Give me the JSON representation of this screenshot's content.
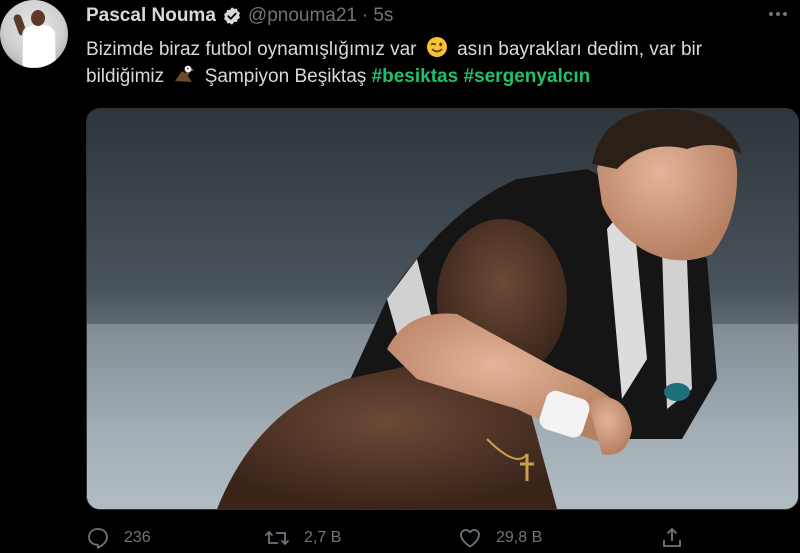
{
  "user": {
    "display_name": "Pascal Nouma",
    "handle": "@pnouma21",
    "separator": "·",
    "time": "5s",
    "avatar_icon": "profile-avatar"
  },
  "tweet": {
    "line1_before": "Bizimde biraz futbol oynamışlığımız var",
    "line1_emoji": "winking-face-emoji",
    "line1_after": "asın bayrakları dedim, var bir",
    "line2_before": "bildiğimiz",
    "line2_emoji": "eagle-emoji",
    "line2_text": "Şampiyon Beşiktaş",
    "hashtag1": "#besiktas",
    "hashtag2": "#sergenyalcın"
  },
  "media": {
    "alt": "photo"
  },
  "actions": {
    "reply_count": "236",
    "retweet_count": "2,7 B",
    "like_count": "29,8 B"
  },
  "colors": {
    "background": "#000000",
    "text": "#d9d9d9",
    "muted": "#6e767d",
    "hashtag": "#1fc26a"
  }
}
